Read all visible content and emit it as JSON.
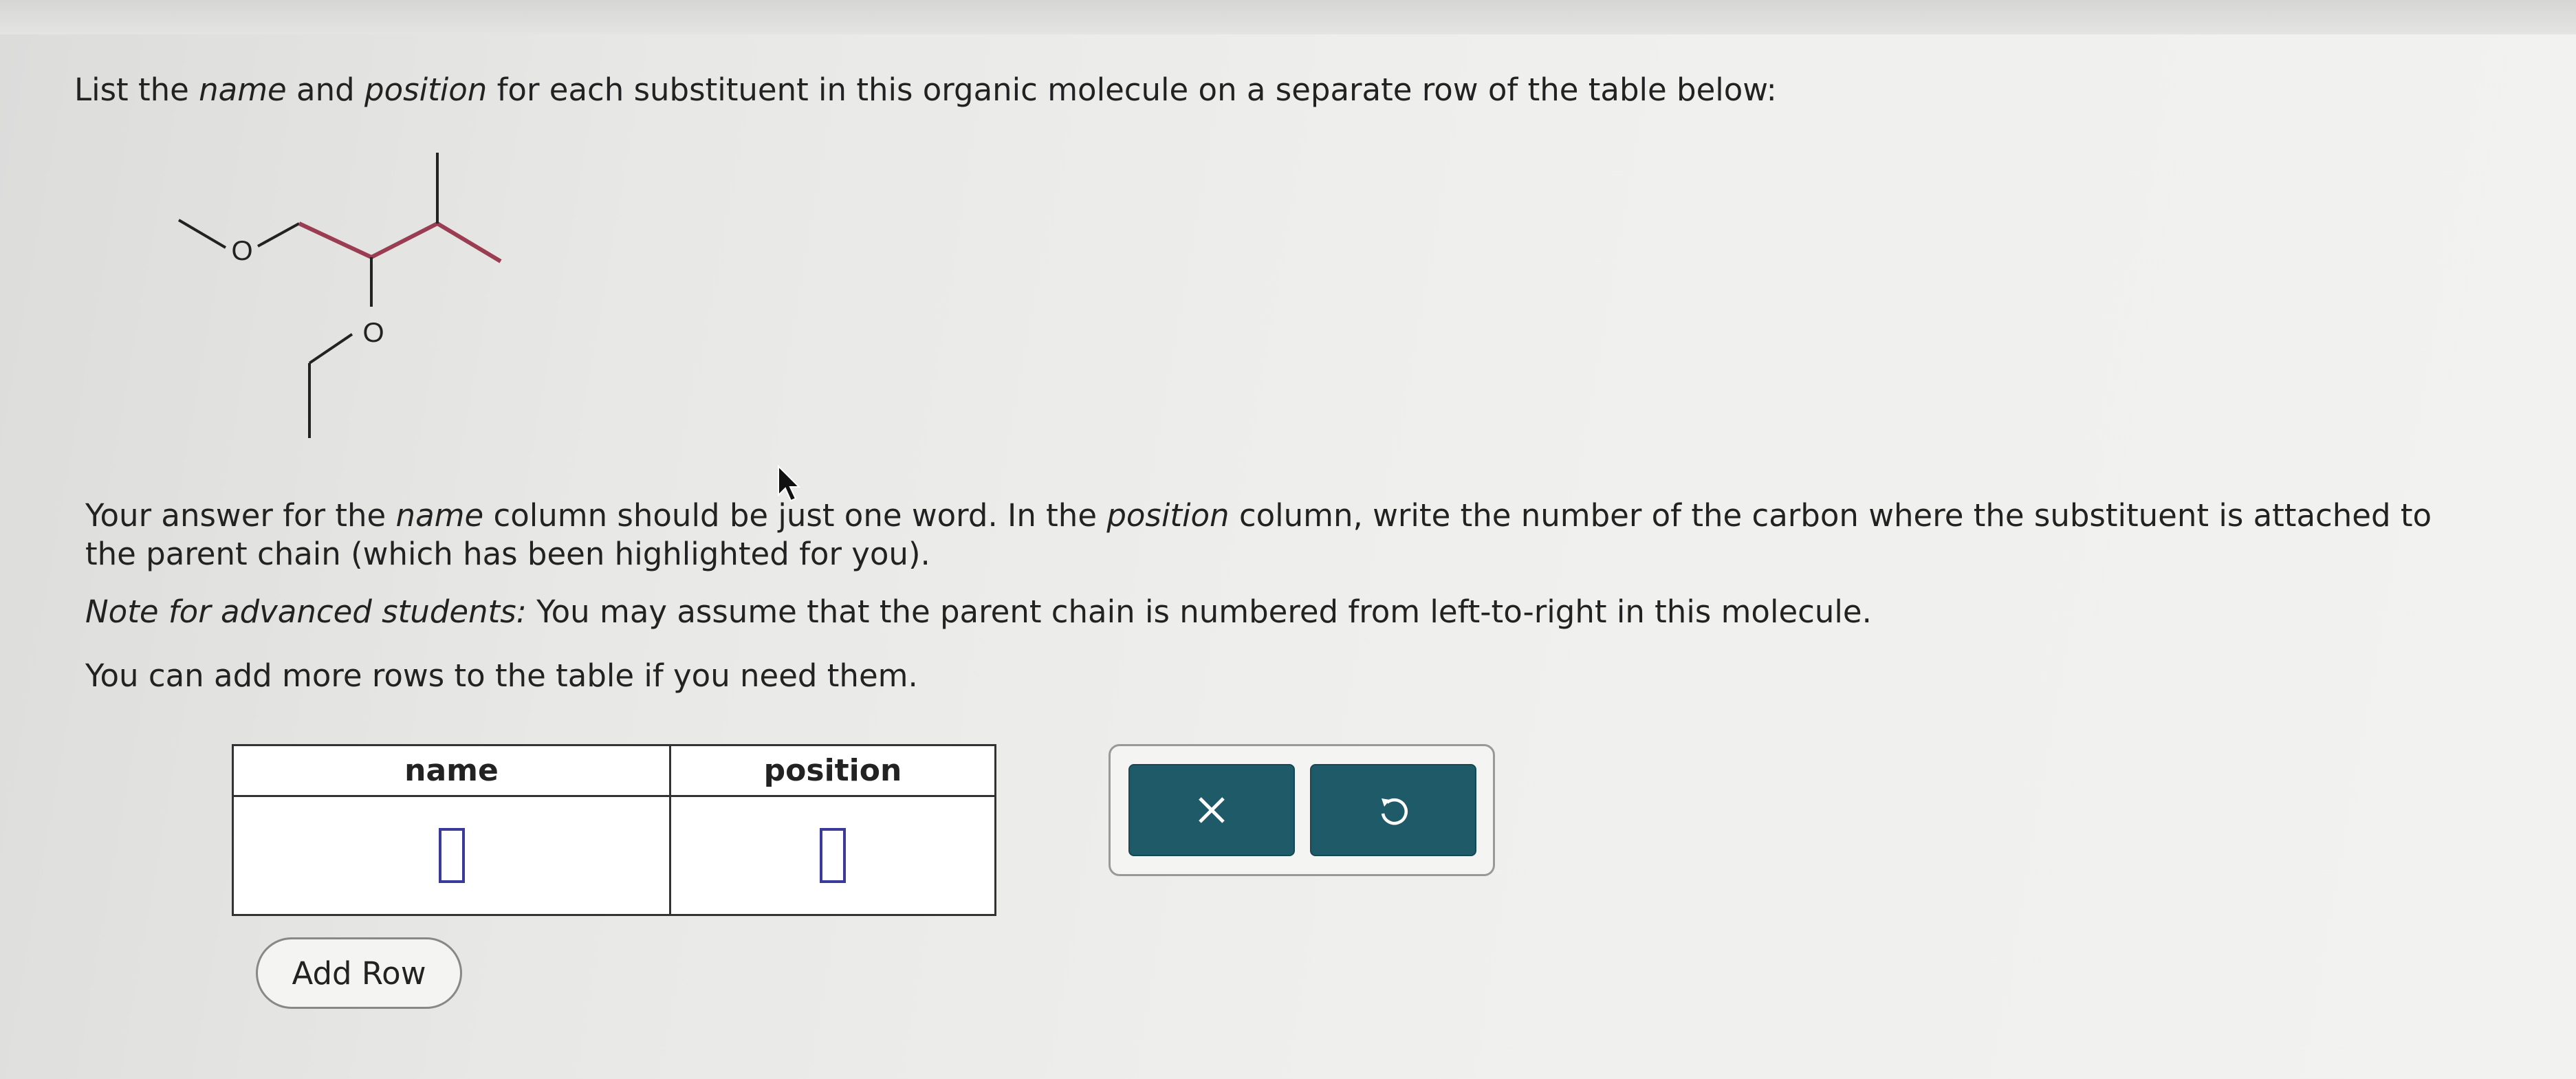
{
  "instructions": {
    "prompt": {
      "part1": "List the ",
      "name_word": "name",
      "part2": " and ",
      "position_word": "position",
      "part3": " for each substituent in this organic molecule on a separate row of the table below:"
    },
    "answer_note": {
      "part1": "Your answer for the ",
      "name_word": "name",
      "part2": " column should be just one word. In the ",
      "position_word": "position",
      "part3": " column, write the number of the carbon where the substituent is attached to the parent chain (which has been highlighted for you)."
    },
    "advanced_note": {
      "label": "Note for advanced students:",
      "text": " You may assume that the parent chain is numbered from left-to-right in this molecule."
    },
    "rows_note": "You can add more rows to the table if you need them."
  },
  "molecule": {
    "oxygen_label_1": "O",
    "oxygen_label_2": "O",
    "parent_chain_color": "#9b3d52",
    "bond_color": "#222222"
  },
  "answer_table": {
    "headers": [
      "name",
      "position"
    ],
    "rows": [
      {
        "name": "",
        "position": ""
      }
    ]
  },
  "buttons": {
    "add_row": "Add Row",
    "clear_icon": "close-x-icon",
    "undo_icon": "undo-arrow-icon"
  },
  "colors": {
    "action_button": "#1f5a68",
    "input_border": "#3a3a9a"
  }
}
